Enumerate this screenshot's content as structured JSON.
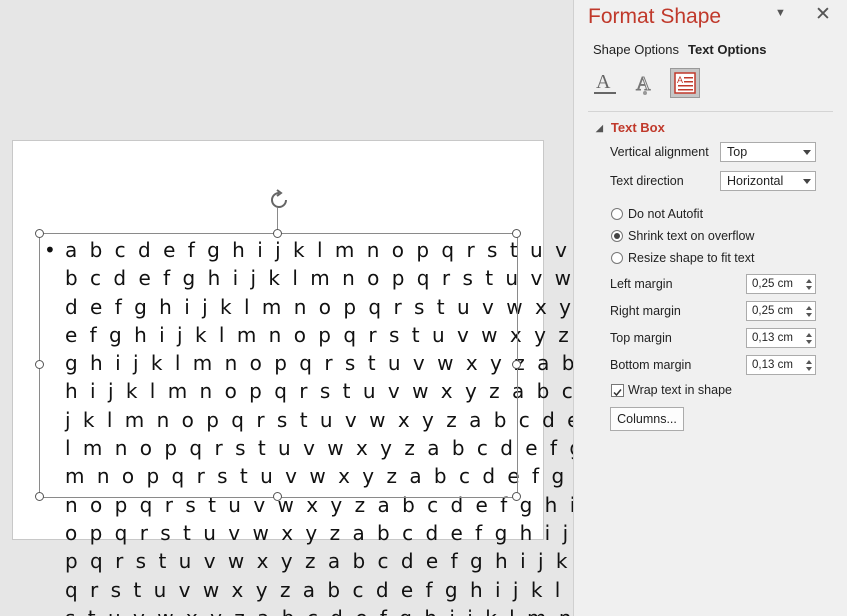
{
  "slide": {
    "lines": [
      "a b c d e f g h i j k l m n o p q r s t u v w x y z a",
      "b c d e f g h i j k l m n o p q r s t u v w x y z a b c",
      "d e f g h i j k l m n o p q r s t u v w x y z a b c d",
      "e f g h i j k l m n o p q r s t u v w x y z a b c d e f",
      "g h i j k l m n o p q r s t u v w x y z a b c d e f g",
      "h i j k l m n o p q r s t u v w x y z a b c d e f g h i",
      "j k l m n o p q r s t u v w x y z a b c d e f g h i j k",
      "l m n o p q r s t u v w x y z a b c d e f g h i j k l",
      "m n o p q r s t u v w x y z a b c d e f g h i j k l m",
      "n o p q r s t u v w x y z a b c d e f g h i j k l m n",
      "o p q r s t u v w x y z a b c d e f g h i j k l m n o",
      "p q r s t u v w x y z a b c d e f g h i j k l m n o p",
      "q r s t u v w x y z a b c d e f g h i j k l m n o p q r",
      "s t u v w x y z a b c d e f g h i j k l m n o p q r s t"
    ],
    "bullet": "•"
  },
  "pane": {
    "title": "Format Shape",
    "tabs": {
      "shape": "Shape Options",
      "text": "Text Options"
    },
    "section": "Text Box",
    "vertical_alignment": {
      "label": "Vertical alignment",
      "value": "Top"
    },
    "text_direction": {
      "label": "Text direction",
      "value": "Horizontal"
    },
    "autofit": {
      "do_not": "Do not Autofit",
      "shrink": "Shrink text on overflow",
      "resize": "Resize shape to fit text",
      "selected": "shrink"
    },
    "margins": {
      "left": {
        "label": "Left margin",
        "value": "0,25 cm"
      },
      "right": {
        "label": "Right margin",
        "value": "0,25 cm"
      },
      "top": {
        "label": "Top margin",
        "value": "0,13 cm"
      },
      "bottom": {
        "label": "Bottom margin",
        "value": "0,13 cm"
      }
    },
    "wrap": {
      "label": "Wrap text in shape",
      "checked": true
    },
    "columns_button": "Columns..."
  },
  "colors": {
    "accent": "#c0392b",
    "selected_icon_bg": "#c6c6c6"
  },
  "icons": [
    "text-fill-outline-icon",
    "text-effects-icon",
    "textbox-layout-icon",
    "rotate-handle-icon",
    "close-icon",
    "chevron-down-icon"
  ]
}
